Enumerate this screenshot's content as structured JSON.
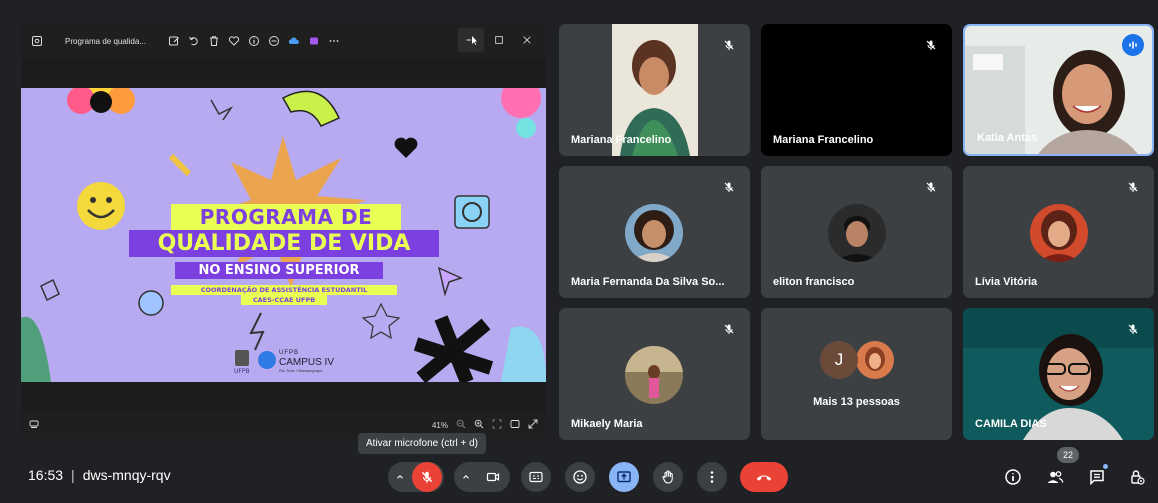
{
  "presentation": {
    "window_title": "Programa de qualida...",
    "zoom_level": "41%",
    "slide": {
      "title_line1": "PROGRAMA DE",
      "title_line2": "QUALIDADE DE VIDA",
      "title_line3": "NO ENSINO SUPERIOR",
      "subtitle_line1": "COORDENAÇÃO DE ASSISTÊNCIA ESTUDANTIL",
      "subtitle_line2": "CAES-CCAE UFPB",
      "logo_ufpb": "UFPB",
      "logo_campus_top": "UFPB",
      "logo_campus": "CAMPUS IV",
      "logo_campus_sub": "Rio Tinto / Mamanguape"
    }
  },
  "tiles": [
    {
      "name": "Mariana Francelino",
      "muted": true
    },
    {
      "name": "Mariana Francelino",
      "muted": true
    },
    {
      "name": "Katia Antas",
      "muted": false,
      "speaking": true
    },
    {
      "name": "Maria Fernanda Da Silva So...",
      "muted": true
    },
    {
      "name": "eliton francisco",
      "muted": true
    },
    {
      "name": "Lívia Vitória",
      "muted": true
    },
    {
      "name": "Mikaely Maria",
      "muted": true
    },
    {
      "name": "Mais 13 pessoas",
      "avatar_letter": "J"
    },
    {
      "name": "CAMILA DIAS",
      "muted": true
    }
  ],
  "bottom_bar": {
    "time": "16:53",
    "meeting_code": "dws-mnqy-rqv",
    "mic_tooltip": "Ativar microfone (ctrl + d)",
    "people_count": "22"
  },
  "colors": {
    "background": "#202124",
    "tile": "#3c4043",
    "danger": "#ea4335",
    "accent": "#8ab4f8",
    "speaking": "#1a73e8"
  }
}
